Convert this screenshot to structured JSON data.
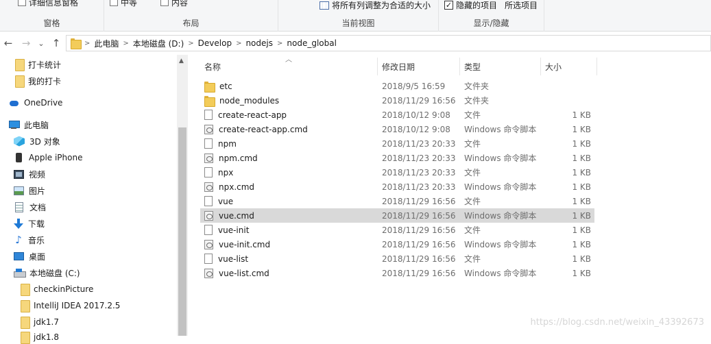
{
  "ribbon": {
    "pane_group_label": "窗格",
    "pane_partial_label": "详细信息窗格",
    "layout_group_label": "布局",
    "layout_partial_a": "中等",
    "layout_partial_b": "内容",
    "current_view_label": "当前视图",
    "fit_columns_label": "将所有列调整为合适的大小",
    "show_hide_label": "显示/隐藏",
    "hidden_items_label": "隐藏的项目",
    "hidden_items_checked": true,
    "hide_selected_label": "所选项目"
  },
  "nav": {
    "back_icon": "←",
    "forward_icon": "→",
    "recent_icon": "⌄",
    "up_icon": "↑",
    "breadcrumb": [
      "此电脑",
      "本地磁盘 (D:)",
      "Develop",
      "nodejs",
      "node_global"
    ]
  },
  "tree": {
    "items": [
      {
        "label": "打卡统计",
        "icon": "folder-icon"
      },
      {
        "label": "我的打卡",
        "icon": "folder-icon"
      },
      {
        "label": "OneDrive",
        "icon": "onedrive-icon"
      },
      {
        "label": "此电脑",
        "icon": "computer-icon"
      },
      {
        "label": "3D 对象",
        "icon": "3d-objects-icon"
      },
      {
        "label": "Apple iPhone",
        "icon": "phone-icon"
      },
      {
        "label": "视频",
        "icon": "video-icon"
      },
      {
        "label": "图片",
        "icon": "pictures-icon"
      },
      {
        "label": "文档",
        "icon": "documents-icon"
      },
      {
        "label": "下载",
        "icon": "download-icon"
      },
      {
        "label": "音乐",
        "icon": "music-icon"
      },
      {
        "label": "桌面",
        "icon": "desktop-icon"
      },
      {
        "label": "本地磁盘 (C:)",
        "icon": "drive-icon"
      },
      {
        "label": "checkinPicture",
        "icon": "folder-icon"
      },
      {
        "label": "IntelliJ IDEA 2017.2.5",
        "icon": "folder-icon"
      },
      {
        "label": "jdk1.7",
        "icon": "folder-icon"
      },
      {
        "label": "jdk1.8",
        "icon": "folder-icon"
      }
    ]
  },
  "columns": {
    "name": "名称",
    "modified": "修改日期",
    "type": "类型",
    "size": "大小"
  },
  "files": [
    {
      "name": "etc",
      "date": "2018/9/5 16:59",
      "type": "文件夹",
      "size": "",
      "icon": "folder-icon"
    },
    {
      "name": "node_modules",
      "date": "2018/11/29 16:56",
      "type": "文件夹",
      "size": "",
      "icon": "folder-icon"
    },
    {
      "name": "create-react-app",
      "date": "2018/10/12 9:08",
      "type": "文件",
      "size": "1 KB",
      "icon": "file-icon"
    },
    {
      "name": "create-react-app.cmd",
      "date": "2018/10/12 9:08",
      "type": "Windows 命令脚本",
      "size": "1 KB",
      "icon": "cmd-script-icon"
    },
    {
      "name": "npm",
      "date": "2018/11/23 20:33",
      "type": "文件",
      "size": "1 KB",
      "icon": "file-icon"
    },
    {
      "name": "npm.cmd",
      "date": "2018/11/23 20:33",
      "type": "Windows 命令脚本",
      "size": "1 KB",
      "icon": "cmd-script-icon"
    },
    {
      "name": "npx",
      "date": "2018/11/23 20:33",
      "type": "文件",
      "size": "1 KB",
      "icon": "file-icon"
    },
    {
      "name": "npx.cmd",
      "date": "2018/11/23 20:33",
      "type": "Windows 命令脚本",
      "size": "1 KB",
      "icon": "cmd-script-icon"
    },
    {
      "name": "vue",
      "date": "2018/11/29 16:56",
      "type": "文件",
      "size": "1 KB",
      "icon": "file-icon"
    },
    {
      "name": "vue.cmd",
      "date": "2018/11/29 16:56",
      "type": "Windows 命令脚本",
      "size": "1 KB",
      "icon": "cmd-script-icon",
      "selected": true
    },
    {
      "name": "vue-init",
      "date": "2018/11/29 16:56",
      "type": "文件",
      "size": "1 KB",
      "icon": "file-icon"
    },
    {
      "name": "vue-init.cmd",
      "date": "2018/11/29 16:56",
      "type": "Windows 命令脚本",
      "size": "1 KB",
      "icon": "cmd-script-icon"
    },
    {
      "name": "vue-list",
      "date": "2018/11/29 16:56",
      "type": "文件",
      "size": "1 KB",
      "icon": "file-icon"
    },
    {
      "name": "vue-list.cmd",
      "date": "2018/11/29 16:56",
      "type": "Windows 命令脚本",
      "size": "1 KB",
      "icon": "cmd-script-icon"
    }
  ],
  "watermark": "https://blog.csdn.net/weixin_43392673"
}
